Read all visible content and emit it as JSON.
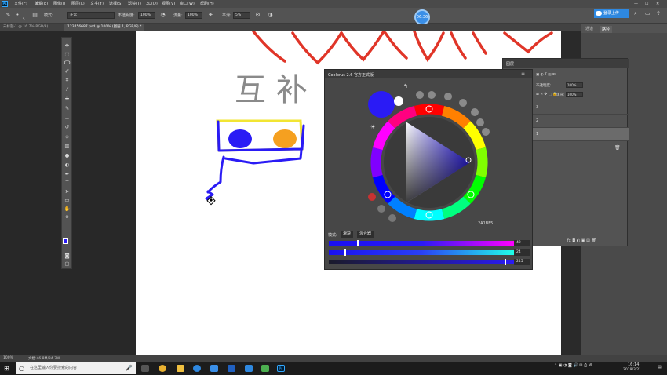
{
  "menu": {
    "items": [
      "文件(F)",
      "编辑(E)",
      "图像(I)",
      "图层(L)",
      "文字(Y)",
      "选择(S)",
      "滤镜(T)",
      "3D(D)",
      "视图(V)",
      "窗口(W)",
      "帮助(H)"
    ]
  },
  "options": {
    "mode_label": "模式:",
    "mode_value": "正常",
    "opacity_label": "不透明度:",
    "opacity_value": "100%",
    "flow_label": "流量:",
    "flow_value": "100%",
    "smoothing_label": "平滑:",
    "smoothing_value": "5%",
    "brush_size": "5"
  },
  "timer": "06:36",
  "login_button": "登录上传",
  "doc_tabs": [
    {
      "label": "未标题-1 @ 16.7%(RGB/8)",
      "active": false
    },
    {
      "label": "123456687.psd @ 100% (图层 1, RGB/8) *",
      "active": true
    }
  ],
  "right_panel_tabs": [
    "通道",
    "路径"
  ],
  "layers_panel": {
    "title": "图层",
    "opacity_label": "不透明度:",
    "opacity_value": "100%",
    "fill_label": "填充:",
    "fill_value": "100%",
    "rows": [
      "3",
      "2",
      "1"
    ],
    "bottom_icons": "fx ◘ ◐ ▣ ▤ 🗑"
  },
  "canvas": {
    "chinese_text": "互 补"
  },
  "coolorus": {
    "title": "Coolorus 2.6 官方正式版",
    "hex_value": "2A1BF5",
    "mode_label": "模式:",
    "mode_btn_1": "滑块",
    "mode_btn_2": "混合器",
    "slider_values": [
      "42",
      "24",
      "245"
    ],
    "current_color": "#2a1bf5",
    "previous_color": "#ffffff"
  },
  "status": {
    "zoom": "100%",
    "doc": "文档:46.8M/34.3M"
  },
  "taskbar": {
    "search_placeholder": "在这里输入你要搜索的内容",
    "time": "16:14",
    "date": "2019/3/21"
  },
  "colors": {
    "accent": "#2e88e0",
    "stroke_red": "#e03528",
    "stroke_blue": "#2a1bf5",
    "stroke_yellow": "#f2e533",
    "stroke_orange": "#f5a020",
    "text_gray": "#8a8a8a"
  },
  "toolbar_icons": [
    "move-icon",
    "marquee-icon",
    "lasso-icon",
    "quick-select-icon",
    "crop-icon",
    "eyedropper-icon",
    "healing-icon",
    "brush-icon",
    "stamp-icon",
    "history-brush-icon",
    "eraser-icon",
    "gradient-icon",
    "blur-icon",
    "dodge-icon",
    "pen-icon",
    "type-icon",
    "path-select-icon",
    "shape-icon",
    "hand-icon",
    "zoom-icon"
  ]
}
